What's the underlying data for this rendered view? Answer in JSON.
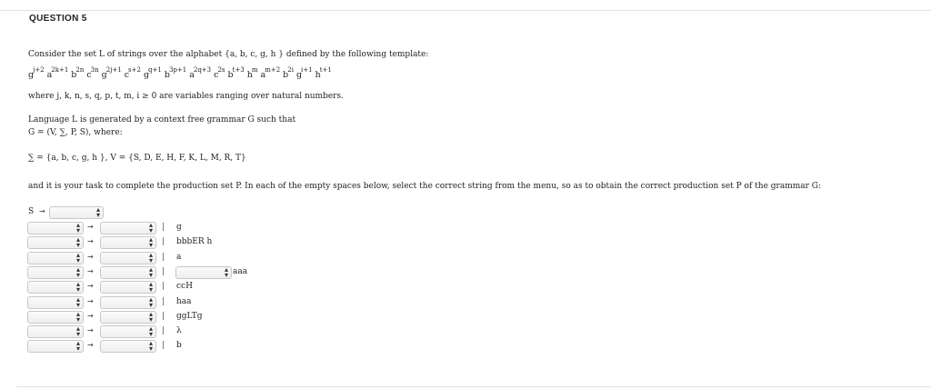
{
  "question": {
    "title": "QUESTION 5",
    "intro": "Consider the set  L  of strings over the alphabet {a, b, c, g, h } defined by the following template:",
    "template": [
      {
        "base": "g",
        "exp": "j+2"
      },
      {
        "base": "a",
        "exp": "2k+1"
      },
      {
        "base": "b",
        "exp": "2n"
      },
      {
        "base": "c",
        "exp": "3n"
      },
      {
        "base": "g",
        "exp": "2j+1"
      },
      {
        "base": "c",
        "exp": "s+2"
      },
      {
        "base": "g",
        "exp": "q+1"
      },
      {
        "base": "b",
        "exp": "3p+1"
      },
      {
        "base": "a",
        "exp": "2q+3"
      },
      {
        "base": "c",
        "exp": "2s"
      },
      {
        "base": "b",
        "exp": "t+3"
      },
      {
        "base": "h",
        "exp": "m"
      },
      {
        "base": "a",
        "exp": "m+2"
      },
      {
        "base": "b",
        "exp": "2i"
      },
      {
        "base": "g",
        "exp": "i+1"
      },
      {
        "base": "h",
        "exp": "t+1"
      }
    ],
    "variables_note": "where  j, k, n, s, q, p, t, m, i ≥ 0   are variables ranging over natural numbers.",
    "grammar_line1": "Language L is generated by a context free grammar G such that",
    "grammar_line2": "G = (V, ∑, P, S),  where:",
    "sigma_line": "∑ = {a, b, c, g, h },   V = {S, D, E, H, F, K, L, M, R, T}",
    "task": "and it is your task to complete the production set P.  In each of the empty spaces below, select the correct string from the menu, so as to obtain the correct production set P of the grammar G:"
  },
  "productions": {
    "start_symbol": "S",
    "arrow": "→",
    "bar": "|",
    "dropdown_arrow": "⬍",
    "rows": [
      {
        "alt_text": "g"
      },
      {
        "alt_text": "bbbER h"
      },
      {
        "alt_text": "a"
      },
      {
        "alt_text": "",
        "inner_select": true,
        "after_text": "aaa"
      },
      {
        "alt_text": "ccH"
      },
      {
        "alt_text": "haa"
      },
      {
        "alt_text": "ggLTg"
      },
      {
        "alt_text": "λ"
      },
      {
        "alt_text": "b"
      }
    ]
  }
}
